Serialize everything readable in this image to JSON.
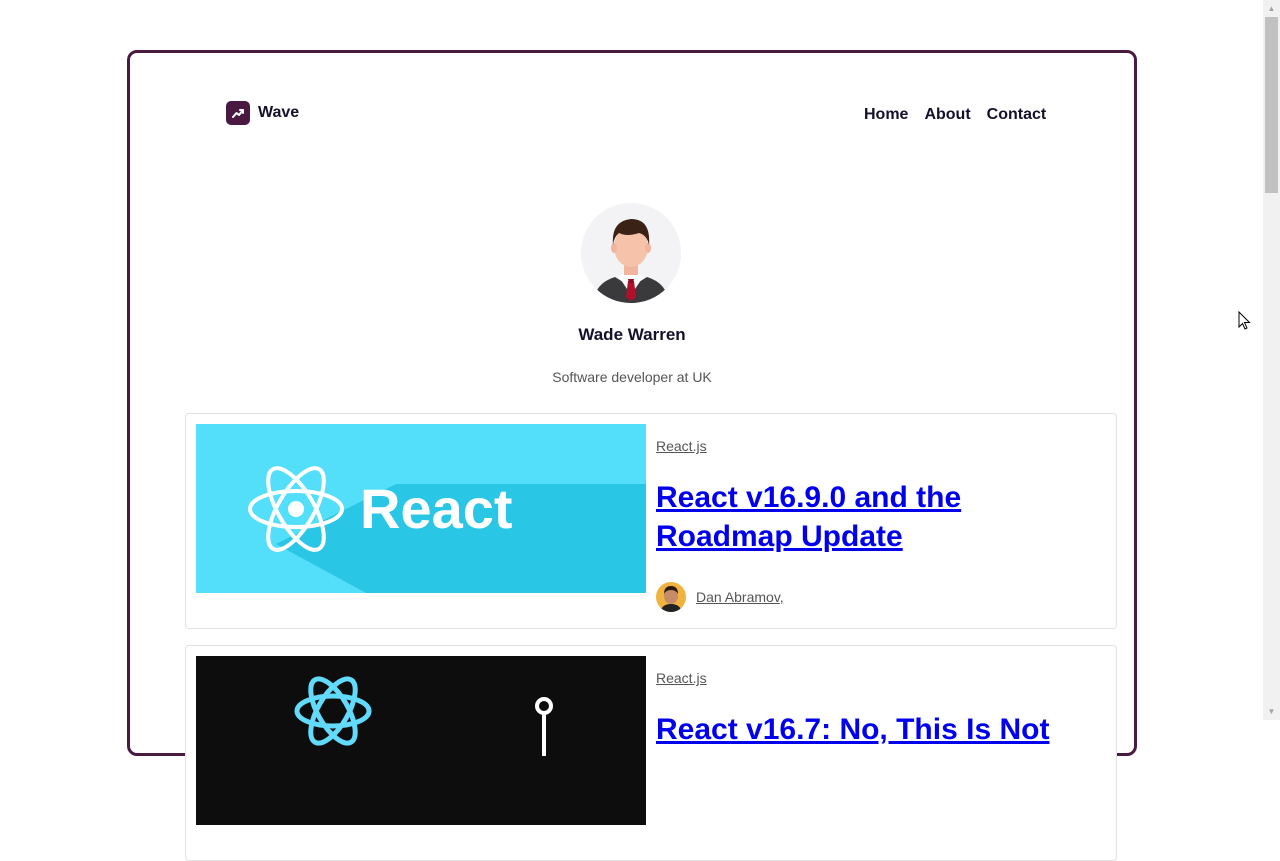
{
  "brand": {
    "name": "Wave",
    "icon": "trending-up-icon",
    "color": "#4a1942"
  },
  "nav": {
    "items": [
      {
        "label": "Home"
      },
      {
        "label": "About"
      },
      {
        "label": "Contact"
      }
    ]
  },
  "author": {
    "name": "Wade Warren",
    "bio": "Software developer at UK",
    "avatar": "man-in-suit-avatar"
  },
  "posts": [
    {
      "tag": "React.js",
      "title": "React v16.9.0 and the Roadmap Update",
      "author": "Dan Abramov",
      "author_suffix": ",",
      "image": {
        "text": "React",
        "background": "#53dff9"
      }
    },
    {
      "tag": "React.js",
      "title": "React v16.7: No, This Is Not",
      "image": {
        "background": "#0d0d0d"
      }
    }
  ]
}
